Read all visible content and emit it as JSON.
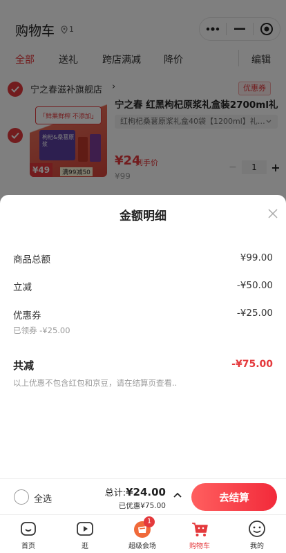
{
  "header": {
    "title": "购物车",
    "location_count": "1"
  },
  "tabs": [
    {
      "label": "全部",
      "active": true
    },
    {
      "label": "送礼",
      "active": false
    },
    {
      "label": "跨店满减",
      "active": false
    },
    {
      "label": "降价",
      "active": false
    }
  ],
  "edit_label": "编辑",
  "store": {
    "name": "宁之春滋补旗舰店",
    "arrow": "›",
    "coupon_tag": "优惠券"
  },
  "product": {
    "title": "宁之春 红黑枸杞原浆礼盒装2700ml礼",
    "sku": "红枸杞桑葚原浆礼盒40袋【1200ml】礼…",
    "image_banner": "「鲜果鲜榨 不添加」",
    "image_box_text": "枸杞&桑葚原浆",
    "image_price": "¥49",
    "image_deal": "满99减50",
    "deal_price": "¥24",
    "deal_label": "到手价",
    "original_price": "¥99",
    "quantity": "1",
    "minus": "−",
    "plus": "+"
  },
  "sheet": {
    "title": "金额明细",
    "rows": [
      {
        "label": "商品总额",
        "value": "¥99.00"
      },
      {
        "label": "立减",
        "value": "-¥50.00"
      },
      {
        "label": "优惠券",
        "value": "-¥25.00",
        "sub": "已领券 -¥25.00"
      }
    ],
    "total_label": "共减",
    "total_value": "-¥75.00",
    "note": "以上优惠不包含红包和京豆，请在结算页查看.."
  },
  "checkout": {
    "select_all_label": "全选",
    "sum_prefix": "总计:",
    "sum_amount": "¥24.00",
    "saved": "已优惠¥75.00",
    "button": "去结算"
  },
  "tabbar": [
    {
      "label": "首页",
      "icon": "home-icon",
      "active": false
    },
    {
      "label": "逛",
      "icon": "video-icon",
      "active": false
    },
    {
      "label": "超级会场",
      "icon": "venue-icon",
      "active": false,
      "badge": "1"
    },
    {
      "label": "购物车",
      "icon": "cart-icon",
      "active": true
    },
    {
      "label": "我的",
      "icon": "profile-icon",
      "active": false
    }
  ],
  "colors": {
    "brand_red": "#e4393c",
    "overlay": "rgba(0,0,0,0.5)"
  }
}
